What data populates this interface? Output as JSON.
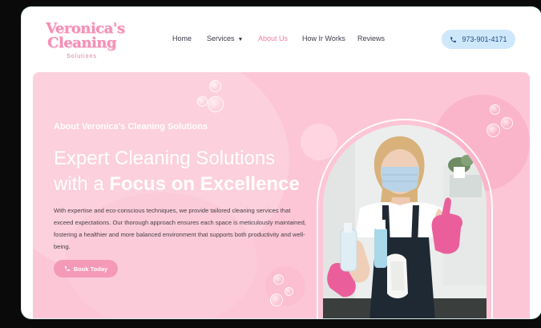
{
  "logo": {
    "line1": "Veronica's",
    "line2": "Cleaning",
    "line3": "Solutions"
  },
  "nav": {
    "items": [
      {
        "label": "Home"
      },
      {
        "label": "Services"
      },
      {
        "label": "About Us"
      },
      {
        "label": "How Ir Works"
      },
      {
        "label": "Reviews"
      }
    ],
    "active": "About Us"
  },
  "header": {
    "phone": "973-901-4171"
  },
  "hero": {
    "eyebrow": "About Veronica's Cleaning Solutions",
    "heading_line1": "Expert Cleaning Solutions",
    "heading_line2_prefix": "with a ",
    "heading_line2_strong": "Focus on Excellence",
    "paragraph": "With expertise and eco-conscious techniques, we provide tailored cleaning services that exceed expectations. Our thorough approach ensures each space is meticulously maintained, fostering a healthier and more balanced environment that supports both productivity and well-being.",
    "book_label": "Book Today"
  },
  "colors": {
    "accent_pink": "#f58fb4",
    "hero_bg": "#fdc6d6",
    "phone_button_bg": "#cfe7fb",
    "active_nav": "#ef7fa8"
  },
  "icons": {
    "phone": "phone-icon",
    "caret": "chevron-down-icon"
  }
}
